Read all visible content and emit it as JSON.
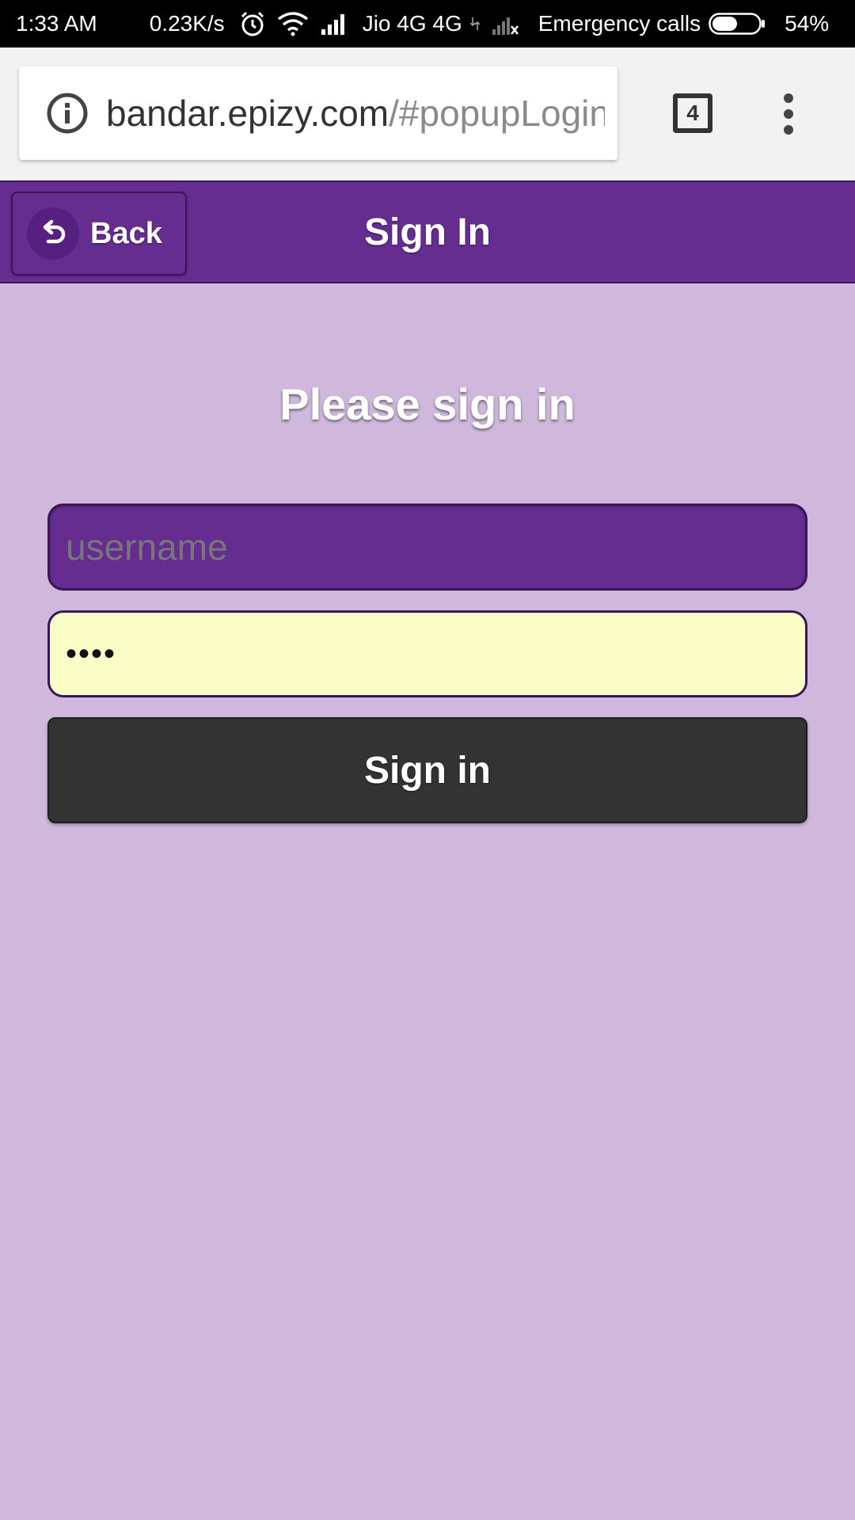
{
  "status_bar": {
    "time": "1:33 AM",
    "network_speed": "0.23K/s",
    "carrier": "Jio 4G 4G",
    "emergency": "Emergency calls",
    "battery_percent": "54%",
    "battery_level": 0.54,
    "icons": [
      "alarm-icon",
      "wifi-icon",
      "signal-icon",
      "data-icon",
      "no-signal-icon",
      "battery-icon"
    ]
  },
  "browser": {
    "url_domain": "bandar.epizy.com",
    "url_path": "/#popupLogin",
    "tab_count": "4",
    "icons": [
      "info-icon",
      "tab-switcher-icon",
      "overflow-menu-icon"
    ]
  },
  "header": {
    "back_label": "Back",
    "title": "Sign In",
    "icons": [
      "back-arrow-icon"
    ]
  },
  "form": {
    "heading": "Please sign in",
    "username_placeholder": "username",
    "username_value": "",
    "password_value": "••••",
    "submit_label": "Sign in"
  },
  "colors": {
    "page_background": "#cfb8dc",
    "header_background": "#662d91",
    "password_field_background": "#fafdc6",
    "button_background": "#333333",
    "status_bar_background": "#000000"
  }
}
